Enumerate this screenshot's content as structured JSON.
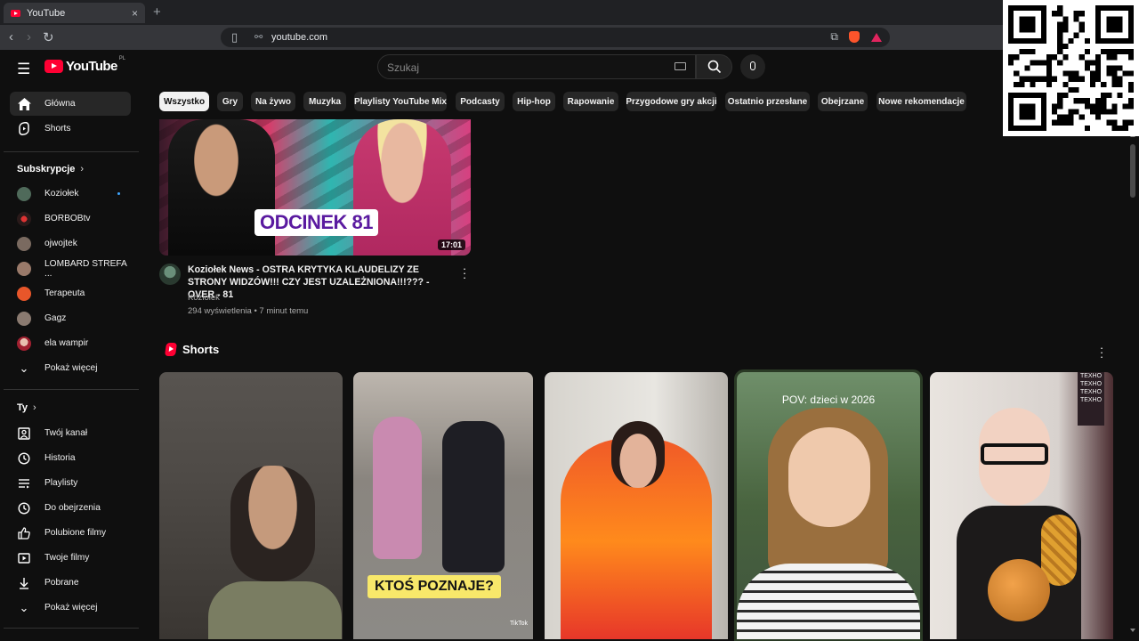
{
  "browser": {
    "tab_title": "YouTube",
    "tab_close": "×",
    "new_tab": "+",
    "url": "youtube.com",
    "back": "‹",
    "forward": "›",
    "reload": "↻"
  },
  "header": {
    "logo_text": "YouTube",
    "logo_country": "PL",
    "search_placeholder": "Szukaj"
  },
  "sidebar": {
    "top": [
      {
        "label": "Główna",
        "icon": "home-icon",
        "active": true
      },
      {
        "label": "Shorts",
        "icon": "shorts-icon",
        "active": false
      }
    ],
    "subscriptions_heading": "Subskrypcje",
    "subscriptions": [
      {
        "label": "Koziołek",
        "new": true,
        "avatar_color": "#4f6a5a"
      },
      {
        "label": "BORBOBtv",
        "new": false,
        "avatar_color": "#3a2a2a"
      },
      {
        "label": "ojwojtek",
        "new": false,
        "avatar_color": "#7a6a60"
      },
      {
        "label": "LOMBARD STREFA ...",
        "new": false,
        "avatar_color": "#9a7a6a"
      },
      {
        "label": "Terapeuta",
        "new": false,
        "avatar_color": "#e8562a"
      },
      {
        "label": "Gagz",
        "new": false,
        "avatar_color": "#8a7a70"
      },
      {
        "label": "ela wampir",
        "new": false,
        "avatar_color": "#a02030"
      }
    ],
    "show_more_1": "Pokaż więcej",
    "you_heading": "Ty",
    "you_items": [
      {
        "label": "Twój kanał",
        "icon": "channel-icon"
      },
      {
        "label": "Historia",
        "icon": "history-icon"
      },
      {
        "label": "Playlisty",
        "icon": "playlist-icon"
      },
      {
        "label": "Do obejrzenia",
        "icon": "watch-later-icon"
      },
      {
        "label": "Polubione filmy",
        "icon": "like-icon"
      },
      {
        "label": "Twoje filmy",
        "icon": "your-videos-icon"
      },
      {
        "label": "Pobrane",
        "icon": "download-icon"
      }
    ],
    "show_more_2": "Pokaż więcej"
  },
  "chips": [
    "Wszystko",
    "Gry",
    "Na żywo",
    "Muzyka",
    "Playlisty YouTube Mix",
    "Podcasty",
    "Hip-hop",
    "Rapowanie",
    "Przygodowe gry akcji",
    "Ostatnio przesłane",
    "Obejrzane",
    "Nowe rekomendacje"
  ],
  "video": {
    "thumb_label": "ODCINEK 81",
    "duration": "17:01",
    "title": "Koziołek News - OSTRA KRYTYKA KLAUDELIZY ZE STRONY WIDZÓW!!! CZY JEST UZALEŻNIONA!!!??? - OVER - 81",
    "channel": "Koziołek",
    "meta": "294 wyświetlenia • 7 minut temu"
  },
  "shorts": {
    "heading": "Shorts",
    "items": [
      {
        "caption": ""
      },
      {
        "caption": "KTOŚ POZNAJE?",
        "watermark": "TikTok"
      },
      {
        "caption": ""
      },
      {
        "caption": "POV: dzieci w 2026"
      },
      {
        "caption": "",
        "poster": "TEXHO TEXHO TEXHO TEXHO"
      }
    ]
  }
}
